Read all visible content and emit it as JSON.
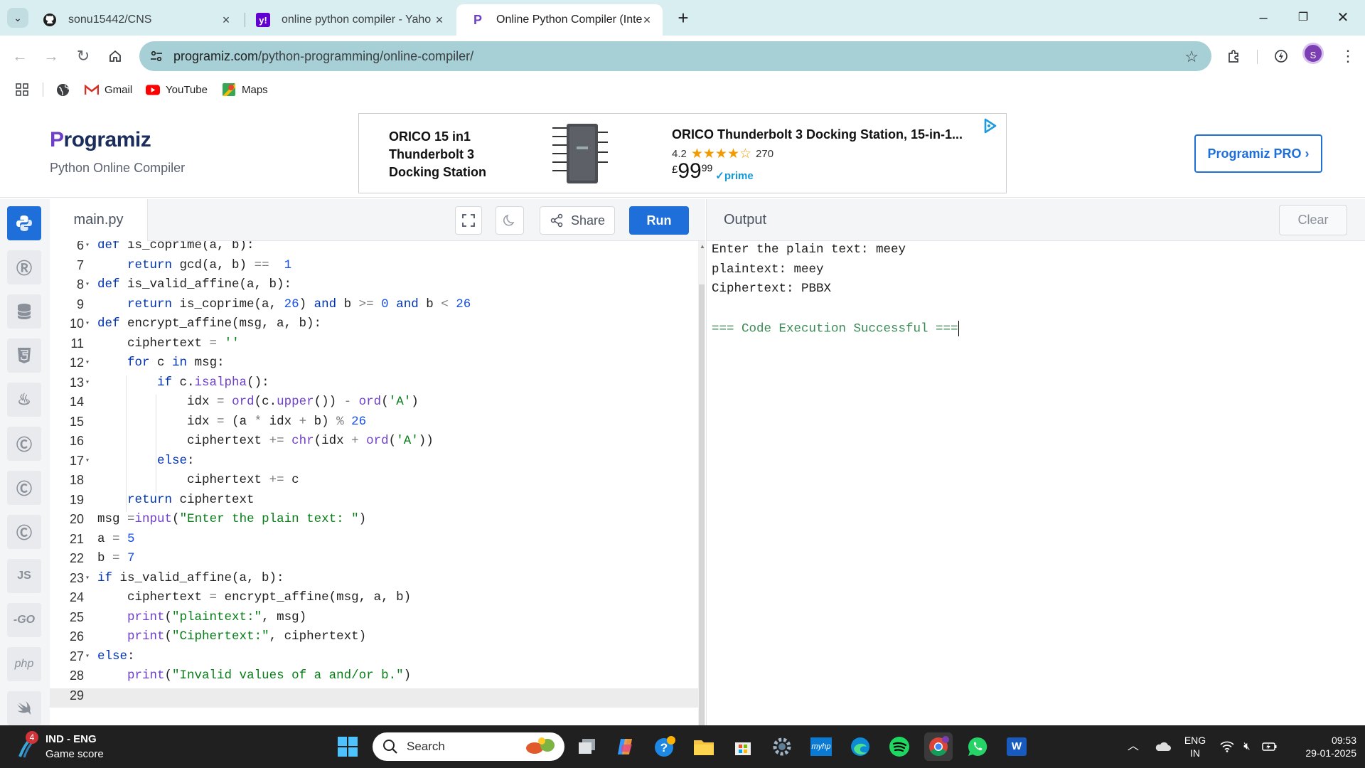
{
  "browser": {
    "tabs": [
      {
        "title": "sonu15442/CNS",
        "icon": "github-icon"
      },
      {
        "title": "online python compiler - Yahoo",
        "icon": "yahoo-icon"
      },
      {
        "title": "Online Python Compiler (Interpreter)",
        "icon": "programiz-icon"
      }
    ],
    "url_domain": "programiz.com",
    "url_path": "/python-programming/online-compiler/",
    "profile_initial": "S",
    "bookmarks": [
      {
        "label": "Gmail",
        "icon": "gmail-icon"
      },
      {
        "label": "YouTube",
        "icon": "youtube-icon"
      },
      {
        "label": "Maps",
        "icon": "maps-icon"
      }
    ]
  },
  "site": {
    "logo_text": "rogramiz",
    "logo_p": "P",
    "subtitle": "Python Online Compiler",
    "pro_button": "Programiz PRO ›"
  },
  "ad": {
    "headline": "ORICO 15 in1 Thunderbolt 3 Docking Station",
    "product": "ORICO Thunderbolt 3 Docking Station, 15-in-1...",
    "rating": "4.2",
    "stars": "★★★★☆",
    "reviews": "270",
    "currency": "£",
    "price_whole": "99",
    "price_cents": "99",
    "prime": "✓prime"
  },
  "editor": {
    "filename": "main.py",
    "share_label": "Share",
    "run_label": "Run",
    "lines": [
      {
        "n": "6",
        "fold": true
      },
      {
        "n": "7",
        "fold": false
      },
      {
        "n": "8",
        "fold": true
      },
      {
        "n": "9",
        "fold": false
      },
      {
        "n": "10",
        "fold": true
      },
      {
        "n": "11",
        "fold": false
      },
      {
        "n": "12",
        "fold": true
      },
      {
        "n": "13",
        "fold": true
      },
      {
        "n": "14",
        "fold": false
      },
      {
        "n": "15",
        "fold": false
      },
      {
        "n": "16",
        "fold": false
      },
      {
        "n": "17",
        "fold": true
      },
      {
        "n": "18",
        "fold": false
      },
      {
        "n": "19",
        "fold": false
      },
      {
        "n": "20",
        "fold": false
      },
      {
        "n": "21",
        "fold": false
      },
      {
        "n": "22",
        "fold": false
      },
      {
        "n": "23",
        "fold": true
      },
      {
        "n": "24",
        "fold": false
      },
      {
        "n": "25",
        "fold": false
      },
      {
        "n": "26",
        "fold": false
      },
      {
        "n": "27",
        "fold": true
      },
      {
        "n": "28",
        "fold": false
      },
      {
        "n": "29",
        "fold": false
      }
    ],
    "code": [
      [
        [
          "kw",
          "def "
        ],
        [
          "fn",
          "is_coprime(a, b):"
        ]
      ],
      [
        [
          "",
          "    "
        ],
        [
          "kw",
          "return "
        ],
        [
          "fn",
          "gcd(a, b) "
        ],
        [
          "op",
          "=="
        ],
        [
          "",
          "  "
        ],
        [
          "num",
          "1"
        ]
      ],
      [
        [
          "kw",
          "def "
        ],
        [
          "fn",
          "is_valid_affine(a, b):"
        ]
      ],
      [
        [
          "",
          "    "
        ],
        [
          "kw",
          "return "
        ],
        [
          "fn",
          "is_coprime(a, "
        ],
        [
          "num",
          "26"
        ],
        [
          "fn",
          ") "
        ],
        [
          "kw",
          "and"
        ],
        [
          "fn",
          " b "
        ],
        [
          "op",
          ">="
        ],
        [
          "fn",
          " "
        ],
        [
          "num",
          "0"
        ],
        [
          "fn",
          " "
        ],
        [
          "kw",
          "and"
        ],
        [
          "fn",
          " b "
        ],
        [
          "op",
          "<"
        ],
        [
          "fn",
          " "
        ],
        [
          "num",
          "26"
        ]
      ],
      [
        [
          "kw",
          "def "
        ],
        [
          "fn",
          "encrypt_affine(msg, a, b):"
        ]
      ],
      [
        [
          "",
          "    "
        ],
        [
          "fn",
          "ciphertext "
        ],
        [
          "op",
          "="
        ],
        [
          "fn",
          " "
        ],
        [
          "str",
          "''"
        ]
      ],
      [
        [
          "",
          "    "
        ],
        [
          "kw",
          "for"
        ],
        [
          "fn",
          " c "
        ],
        [
          "kw",
          "in"
        ],
        [
          "fn",
          " msg:"
        ]
      ],
      [
        [
          "",
          "        "
        ],
        [
          "kw",
          "if"
        ],
        [
          "fn",
          " c."
        ],
        [
          "bi",
          "isalpha"
        ],
        [
          "fn",
          "():"
        ]
      ],
      [
        [
          "",
          "            "
        ],
        [
          "fn",
          "idx "
        ],
        [
          "op",
          "="
        ],
        [
          "fn",
          " "
        ],
        [
          "bi",
          "ord"
        ],
        [
          "fn",
          "(c."
        ],
        [
          "bi",
          "upper"
        ],
        [
          "fn",
          "()) "
        ],
        [
          "op",
          "-"
        ],
        [
          "fn",
          " "
        ],
        [
          "bi",
          "ord"
        ],
        [
          "fn",
          "("
        ],
        [
          "str",
          "'A'"
        ],
        [
          "fn",
          ")"
        ]
      ],
      [
        [
          "",
          "            "
        ],
        [
          "fn",
          "idx "
        ],
        [
          "op",
          "="
        ],
        [
          "fn",
          " (a "
        ],
        [
          "op",
          "*"
        ],
        [
          "fn",
          " idx "
        ],
        [
          "op",
          "+"
        ],
        [
          "fn",
          " b) "
        ],
        [
          "op",
          "%"
        ],
        [
          "fn",
          " "
        ],
        [
          "num",
          "26"
        ]
      ],
      [
        [
          "",
          "            "
        ],
        [
          "fn",
          "ciphertext "
        ],
        [
          "op",
          "+="
        ],
        [
          "fn",
          " "
        ],
        [
          "bi",
          "chr"
        ],
        [
          "fn",
          "(idx "
        ],
        [
          "op",
          "+"
        ],
        [
          "fn",
          " "
        ],
        [
          "bi",
          "ord"
        ],
        [
          "fn",
          "("
        ],
        [
          "str",
          "'A'"
        ],
        [
          "fn",
          "))"
        ]
      ],
      [
        [
          "",
          "        "
        ],
        [
          "kw",
          "else"
        ],
        [
          "fn",
          ":"
        ]
      ],
      [
        [
          "",
          "            "
        ],
        [
          "fn",
          "ciphertext "
        ],
        [
          "op",
          "+="
        ],
        [
          "fn",
          " c"
        ]
      ],
      [
        [
          "",
          "    "
        ],
        [
          "kw",
          "return"
        ],
        [
          "fn",
          " ciphertext"
        ]
      ],
      [
        [
          "fn",
          "msg "
        ],
        [
          "op",
          "="
        ],
        [
          "bi",
          "input"
        ],
        [
          "fn",
          "("
        ],
        [
          "str",
          "\"Enter the plain text: \""
        ],
        [
          "fn",
          ")"
        ]
      ],
      [
        [
          "fn",
          "a "
        ],
        [
          "op",
          "="
        ],
        [
          "fn",
          " "
        ],
        [
          "num",
          "5"
        ]
      ],
      [
        [
          "fn",
          "b "
        ],
        [
          "op",
          "="
        ],
        [
          "fn",
          " "
        ],
        [
          "num",
          "7"
        ]
      ],
      [
        [
          "kw",
          "if"
        ],
        [
          "fn",
          " is_valid_affine(a, b):"
        ]
      ],
      [
        [
          "",
          "    "
        ],
        [
          "fn",
          "ciphertext "
        ],
        [
          "op",
          "="
        ],
        [
          "fn",
          " encrypt_affine(msg, a, b)"
        ]
      ],
      [
        [
          "",
          "    "
        ],
        [
          "bi",
          "print"
        ],
        [
          "fn",
          "("
        ],
        [
          "str",
          "\"plaintext:\""
        ],
        [
          "fn",
          ", msg)"
        ]
      ],
      [
        [
          "",
          "    "
        ],
        [
          "bi",
          "print"
        ],
        [
          "fn",
          "("
        ],
        [
          "str",
          "\"Ciphertext:\""
        ],
        [
          "fn",
          ", ciphertext)"
        ]
      ],
      [
        [
          "kw",
          "else"
        ],
        [
          "fn",
          ":"
        ]
      ],
      [
        [
          "",
          "    "
        ],
        [
          "bi",
          "print"
        ],
        [
          "fn",
          "("
        ],
        [
          "str",
          "\"Invalid values of a and/or b.\""
        ],
        [
          "fn",
          ")"
        ]
      ],
      [
        [
          "",
          ""
        ]
      ]
    ]
  },
  "output": {
    "title": "Output",
    "clear_label": "Clear",
    "lines": [
      "Enter the plain text: meey",
      "plaintext: meey",
      "Ciphertext: PBBX",
      "",
      "=== Code Execution Successful ==="
    ]
  },
  "rail": [
    "python-icon",
    "r-icon",
    "sql-icon",
    "html5-icon",
    "java-icon",
    "c-icon",
    "cpp-icon",
    "csharp-icon",
    "js-icon",
    "go-icon",
    "php-icon",
    "swift-icon"
  ],
  "rail_labels": {
    "js": "JS",
    "go": "-GO",
    "php": "php"
  },
  "taskbar": {
    "badge": "4",
    "widget_title": "IND - ENG",
    "widget_sub": "Game score",
    "search_placeholder": "Search",
    "lang_top": "ENG",
    "lang_bottom": "IN",
    "time": "09:53",
    "date": "29-01-2025"
  },
  "colors": {
    "accent": "#1e6fd9",
    "tabstrip": "#d9eef1",
    "omnibox": "#a6cfd6",
    "success": "#3a8a55"
  }
}
